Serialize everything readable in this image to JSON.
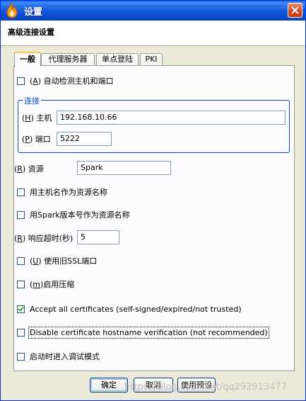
{
  "window": {
    "title": "设置"
  },
  "header": {
    "title": "高级连接设置"
  },
  "tabs": [
    {
      "label": "一般",
      "active": true
    },
    {
      "label": "代理服务器",
      "active": false
    },
    {
      "label": "单点登陆",
      "active": false
    },
    {
      "label": "PKI",
      "active": false
    }
  ],
  "general": {
    "autodetect": {
      "mnemonic": "A",
      "label": "自动检测主机和端口",
      "checked": false
    },
    "connection_group": {
      "legend": "连接",
      "host": {
        "mnemonic": "H",
        "label": "主机",
        "value": "192.168.10.66"
      },
      "port": {
        "mnemonic": "P",
        "label": "端口",
        "value": "5222"
      }
    },
    "resource": {
      "mnemonic": "R",
      "label": "资源",
      "value": "Spark"
    },
    "use_hostname_as_resource": {
      "label": "用主机名作为资源名称",
      "checked": false
    },
    "use_version_as_resource": {
      "label": "用Spark版本号作为资源名称",
      "checked": false
    },
    "timeout": {
      "mnemonic": "R",
      "label": "响应超时(秒)",
      "value": "5"
    },
    "use_old_ssl": {
      "mnemonic": "U",
      "label": "使用旧SSL端口",
      "checked": false
    },
    "compression": {
      "mnemonic": "m",
      "label": "启用压缩",
      "checked": false
    },
    "accept_all_certs": {
      "label": "Accept all certificates (self-signed/expired/not trusted)",
      "checked": true
    },
    "disable_hostname_verification": {
      "label": "Disable certificate hostname verification (not recommended)",
      "checked": false
    },
    "debug_on_startup": {
      "label": "启动时进入调试模式",
      "checked": false
    }
  },
  "buttons": {
    "ok": "确定",
    "cancel": "取消",
    "defaults": "使用预设"
  },
  "watermark": "https://blog.csdn.net/qq292913477",
  "colors": {
    "titlebar": "#0a46c3",
    "group_border": "#0046d5",
    "tab_highlight": "#ffc83c"
  }
}
